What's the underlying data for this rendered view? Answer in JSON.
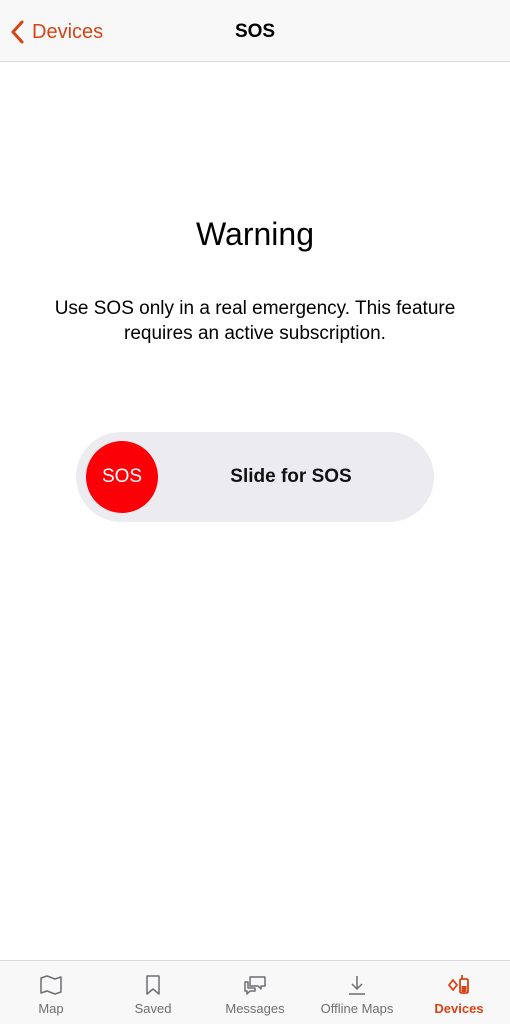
{
  "colors": {
    "accent": "#d84315",
    "sos_red": "#fb0007",
    "slider_track": "#ececf0",
    "inactive_tab": "#6e6e73"
  },
  "navbar": {
    "back_label": "Devices",
    "back_icon": "chevron-left-icon",
    "title": "SOS"
  },
  "content": {
    "heading": "Warning",
    "message": "Use SOS only in a real emergency. This feature requires an active subscription."
  },
  "slider": {
    "knob_label": "SOS",
    "track_label": "Slide for SOS"
  },
  "tabbar": {
    "tabs": [
      {
        "label": "Map",
        "icon": "map-icon",
        "active": false
      },
      {
        "label": "Saved",
        "icon": "bookmark-icon",
        "active": false
      },
      {
        "label": "Messages",
        "icon": "messages-icon",
        "active": false
      },
      {
        "label": "Offline Maps",
        "icon": "download-icon",
        "active": false
      },
      {
        "label": "Devices",
        "icon": "devices-icon",
        "active": true
      }
    ]
  }
}
